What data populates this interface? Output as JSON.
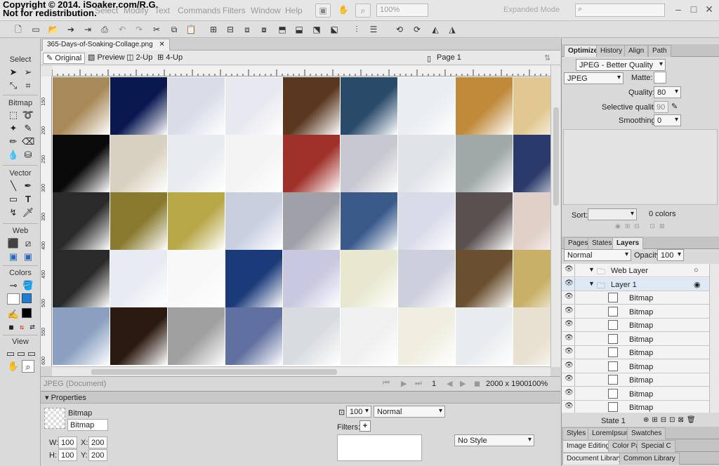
{
  "copyright": "Copyright © 2014. iSoaker.com/R.G.\nNot for redistribution.",
  "menu": [
    "Select",
    "Modify",
    "Text",
    "Commands",
    "Filters",
    "Window",
    "Help"
  ],
  "zoom": "100%",
  "workspace": "Expanded Mode",
  "tools": {
    "sections": [
      "Select",
      "Bitmap",
      "Vector",
      "Web",
      "Colors",
      "View"
    ],
    "stroke_color": "#000000",
    "fill_color": "#1a7fd8"
  },
  "document": {
    "tab_title": "365-Days-of-Soaking-Collage.png",
    "views": [
      "Original",
      "Preview",
      "2-Up",
      "4-Up"
    ],
    "page": "Page 1",
    "ruler_left": [
      "150",
      "200",
      "250",
      "300",
      "350",
      "400",
      "450",
      "500",
      "550",
      "600"
    ],
    "status": {
      "format": "JPEG (Document)",
      "frame": "1",
      "size": "2000 x 1900",
      "zoom": "100%"
    },
    "canvas_cell_colors": [
      [
        "#a88a5a",
        "#0a1850",
        "#d8dde8",
        "#e8e8f0",
        "#5a3820",
        "#2a4a6a",
        "#e8eef2",
        "#c08a3a",
        "#e0c890",
        "#1a4a30"
      ],
      [
        "#0a0a0a",
        "#d8d0c0",
        "#e8ecef",
        "#f4f4f4",
        "#a0302a",
        "#c8c8d0",
        "#e0e4e8",
        "#a0a8a8",
        "#2a3a6a",
        "#101010"
      ],
      [
        "#2a2a2a",
        "#8a7a30",
        "#b8a848",
        "#c8d0e0",
        "#a0a0a8",
        "#3a5a8a",
        "#d8dce8",
        "#5a5050",
        "#e0d0c8",
        "#8a8aa8"
      ],
      [
        "#2a2a2a",
        "#e8ecf2",
        "#f8f8f8",
        "#1a3a7a",
        "#c8c8e0",
        "#e8e8d0",
        "#ccd0dc",
        "#6a5030",
        "#c8b068",
        "#7a6050"
      ],
      [
        "#8aa0c0",
        "#2a1a10",
        "#a0a0a0",
        "#6070a0",
        "#d8dce0",
        "#f0f0f0",
        "#f0eee0",
        "#e8ecef",
        "#e8e0d0",
        "#3a3a40"
      ]
    ]
  },
  "properties": {
    "title": "Properties",
    "type": "Bitmap",
    "name": "Bitmap",
    "w": "100",
    "h": "100",
    "x": "200",
    "y": "200",
    "opacity": "100",
    "blend": "Normal",
    "filters_label": "Filters:",
    "style": "No Style"
  },
  "optimize": {
    "tabs": [
      "Optimize",
      "History",
      "Align",
      "Path"
    ],
    "preset": "JPEG - Better Quality",
    "format": "JPEG",
    "matte_label": "Matte:",
    "quality_label": "Quality:",
    "quality": "80",
    "selective_label": "Selective quality:",
    "selective": "90",
    "smoothing_label": "Smoothing:",
    "smoothing": "0",
    "sort_label": "Sort:",
    "colors": "0 colors"
  },
  "layers": {
    "tabs": [
      "Pages",
      "States",
      "Layers"
    ],
    "blend": "Normal",
    "opacity_label": "Opacity",
    "opacity": "100",
    "items": [
      {
        "name": "Web Layer",
        "indent": 0,
        "folder": true
      },
      {
        "name": "Layer 1",
        "indent": 0,
        "folder": true,
        "selected": true
      },
      {
        "name": "Bitmap",
        "indent": 1
      },
      {
        "name": "Bitmap",
        "indent": 1
      },
      {
        "name": "Bitmap",
        "indent": 1
      },
      {
        "name": "Bitmap",
        "indent": 1
      },
      {
        "name": "Bitmap",
        "indent": 1
      },
      {
        "name": "Bitmap",
        "indent": 1
      },
      {
        "name": "Bitmap",
        "indent": 1
      },
      {
        "name": "Bitmap",
        "indent": 1
      },
      {
        "name": "Bitmap",
        "indent": 1
      }
    ],
    "state": "State 1"
  },
  "bottom_tabs": {
    "row1": [
      "Styles",
      "LoremIpsum",
      "Swatches"
    ],
    "row2": [
      "Image Editing",
      "Color Pal",
      "Special C"
    ],
    "row3": [
      "Document Library",
      "Common Library"
    ]
  }
}
